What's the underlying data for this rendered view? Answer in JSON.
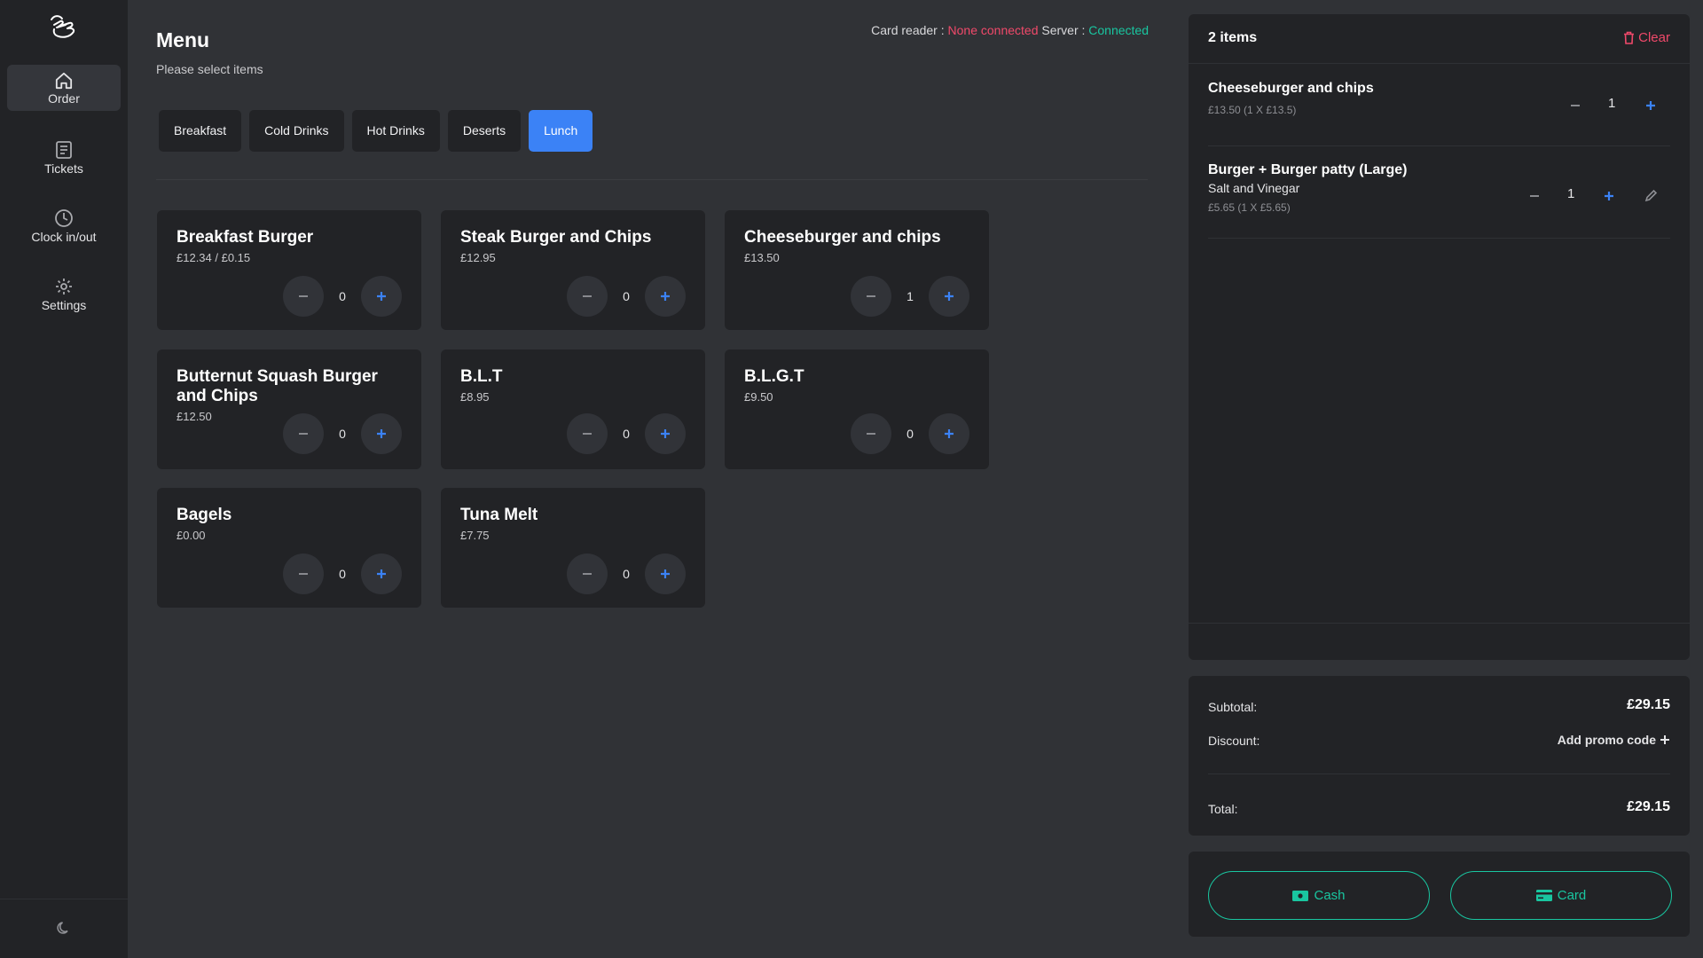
{
  "sidebar": {
    "logo_icon": "hand-tap-icon",
    "items": [
      {
        "label": "Order",
        "icon": "home-icon",
        "active": true
      },
      {
        "label": "Tickets",
        "icon": "receipt-icon",
        "active": false
      },
      {
        "label": "Clock in/out",
        "icon": "clock-icon",
        "active": false
      },
      {
        "label": "Settings",
        "icon": "gear-icon",
        "active": false
      }
    ],
    "theme_icon": "moon-icon"
  },
  "header": {
    "title": "Menu",
    "subtitle": "Please select items",
    "card_reader_label": "Card reader :",
    "card_reader_status": "None connected",
    "server_label": "Server :",
    "server_status": "Connected"
  },
  "tabs": [
    {
      "label": "Breakfast",
      "active": false
    },
    {
      "label": "Cold Drinks",
      "active": false
    },
    {
      "label": "Hot Drinks",
      "active": false
    },
    {
      "label": "Deserts",
      "active": false
    },
    {
      "label": "Lunch",
      "active": true
    }
  ],
  "menu_items": [
    {
      "name": "Breakfast Burger",
      "price": "£12.34 / £0.15",
      "qty": "0"
    },
    {
      "name": "Steak Burger and Chips",
      "price": "£12.95",
      "qty": "0"
    },
    {
      "name": "Cheeseburger and chips",
      "price": "£13.50",
      "qty": "1"
    },
    {
      "name": "Butternut Squash Burger and Chips",
      "price": "£12.50",
      "qty": "0"
    },
    {
      "name": "B.L.T",
      "price": "£8.95",
      "qty": "0"
    },
    {
      "name": "B.L.G.T",
      "price": "£9.50",
      "qty": "0"
    },
    {
      "name": "Bagels",
      "price": "£0.00",
      "qty": "0"
    },
    {
      "name": "Tuna Melt",
      "price": "£7.75",
      "qty": "0"
    }
  ],
  "order": {
    "count_label": "2 items",
    "clear_label": "Clear",
    "items": [
      {
        "name": "Cheeseburger and chips",
        "option": "",
        "price_detail": "£13.50 (1 X £13.5)",
        "qty": "1"
      },
      {
        "name": "Burger + Burger patty (Large)",
        "option": "Salt and Vinegar",
        "price_detail": "£5.65 (1 X £5.65)",
        "qty": "1"
      }
    ]
  },
  "totals": {
    "subtotal_label": "Subtotal:",
    "subtotal_value": "£29.15",
    "discount_label": "Discount:",
    "promo_label": "Add promo code",
    "total_label": "Total:",
    "total_value": "£29.15"
  },
  "payment": {
    "cash_label": "Cash",
    "card_label": "Card"
  },
  "colors": {
    "accent": "#3b82f6",
    "success": "#19c6a0",
    "danger": "#f0496a",
    "panel": "#222326",
    "background": "#303236"
  }
}
